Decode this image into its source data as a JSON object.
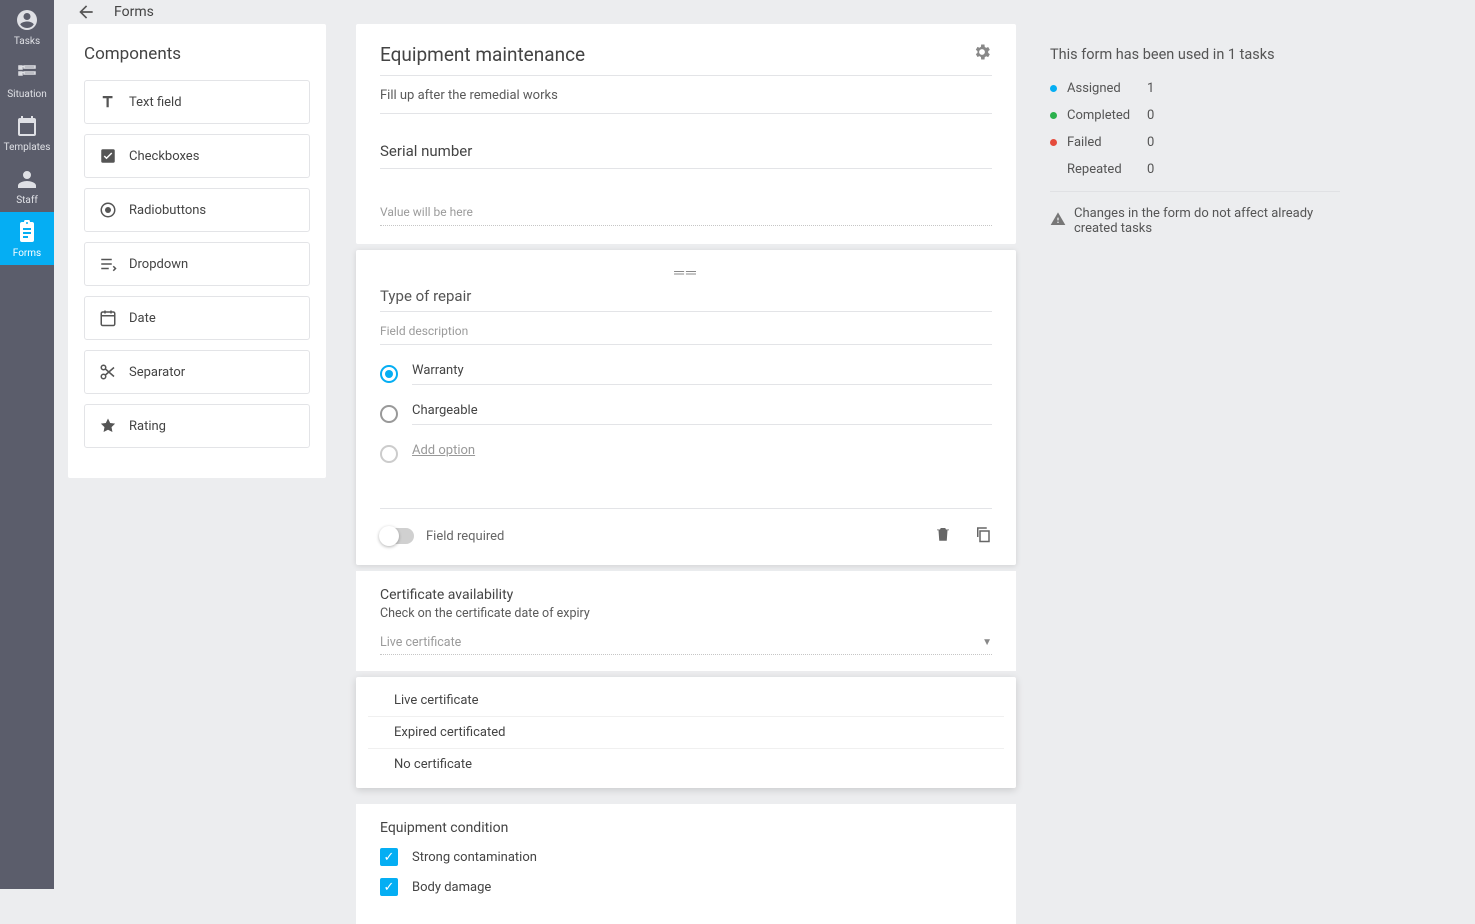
{
  "sidenav": [
    {
      "label": "Tasks"
    },
    {
      "label": "Situation"
    },
    {
      "label": "Templates"
    },
    {
      "label": "Staff"
    },
    {
      "label": "Forms"
    }
  ],
  "topbar": {
    "title": "Forms"
  },
  "components": {
    "title": "Components",
    "items": [
      {
        "label": "Text field"
      },
      {
        "label": "Checkboxes"
      },
      {
        "label": "Radiobuttons"
      },
      {
        "label": "Dropdown"
      },
      {
        "label": "Date"
      },
      {
        "label": "Separator"
      },
      {
        "label": "Rating"
      }
    ]
  },
  "form": {
    "title": "Equipment maintenance",
    "subtitle": "Fill up after the remedial works",
    "serial": {
      "title": "Serial number",
      "placeholder": "Value will be here"
    },
    "repair": {
      "title": "Type of repair",
      "desc_placeholder": "Field description",
      "options": [
        "Warranty",
        "Chargeable"
      ],
      "add_label": "Add option",
      "required_label": "Field required"
    },
    "cert": {
      "title": "Certificate availability",
      "sub": "Check on the certificate date of expiry",
      "selected": "Live certificate",
      "options": [
        "Live certificate",
        "Expired certificated",
        "No certificate"
      ]
    },
    "equip": {
      "title": "Equipment condition",
      "checks": [
        "Strong contamination",
        "Body damage"
      ]
    }
  },
  "info": {
    "title": "This form has been used in 1 tasks",
    "rows": [
      {
        "color": "blue",
        "label": "Assigned",
        "value": "1"
      },
      {
        "color": "green",
        "label": "Completed",
        "value": "0"
      },
      {
        "color": "red",
        "label": "Failed",
        "value": "0"
      },
      {
        "color": "blank",
        "label": "Repeated",
        "value": "0"
      }
    ],
    "warning": "Changes in the form do not affect already created tasks"
  }
}
